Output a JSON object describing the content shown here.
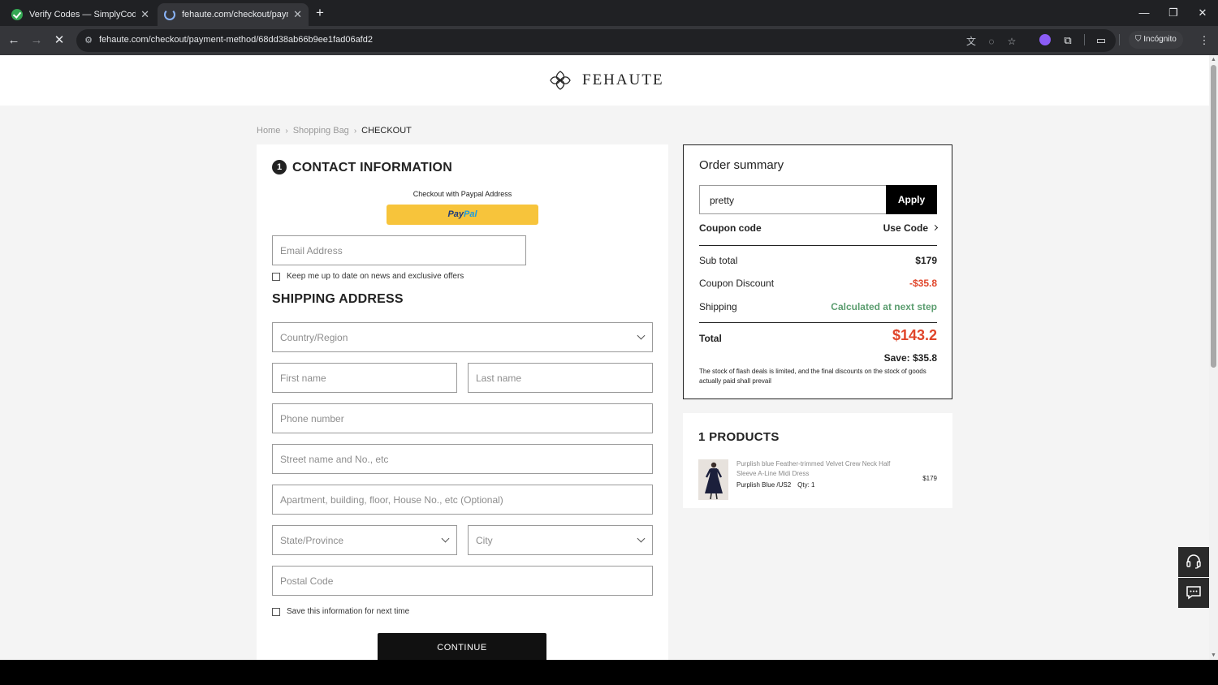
{
  "browser": {
    "tabs": [
      {
        "title": "Verify Codes — SimplyCodes",
        "active": false
      },
      {
        "title": "fehaute.com/checkout/paymen",
        "active": true
      }
    ],
    "url": "fehaute.com/checkout/payment-method/68dd38ab66b9ee1fad06afd2",
    "profile_label": "Incógnito",
    "icons": [
      "back-icon",
      "forward-icon",
      "stop-icon",
      "translate-icon",
      "eye-off-icon",
      "star-icon",
      "extension-icon",
      "puzzle-icon",
      "sidepanel-icon",
      "incognito-icon",
      "menu-icon"
    ]
  },
  "site": {
    "brand": "FEHAUTE",
    "breadcrumb": [
      "Home",
      "Shopping Bag",
      "CHECKOUT"
    ]
  },
  "contact": {
    "step": "1",
    "title": "CONTACT INFORMATION",
    "paypal_caption": "Checkout with Paypal Address",
    "paypal_label_1": "Pay",
    "paypal_label_2": "Pal",
    "email_placeholder": "Email Address",
    "newsletter_label": "Keep me up to date on news and exclusive offers"
  },
  "shipping": {
    "title": "SHIPPING ADDRESS",
    "country_placeholder": "Country/Region",
    "first_name_placeholder": "First name",
    "last_name_placeholder": "Last name",
    "phone_placeholder": "Phone number",
    "street_placeholder": "Street name and No., etc",
    "apartment_placeholder": "Apartment, building, floor, House No., etc (Optional)",
    "state_placeholder": "State/Province",
    "city_placeholder": "City",
    "postal_placeholder": "Postal Code",
    "save_info_label": "Save this information for next time",
    "continue_label": "CONTINUE"
  },
  "summary": {
    "title": "Order summary",
    "coupon_value": "pretty",
    "apply_label": "Apply",
    "coupon_code_label": "Coupon code",
    "use_code_label": "Use Code",
    "subtotal_label": "Sub total",
    "subtotal_value": "$179",
    "discount_label": "Coupon Discount",
    "discount_value": "-$35.8",
    "shipping_label": "Shipping",
    "shipping_value": "Calculated at next step",
    "total_label": "Total",
    "total_value": "$143.2",
    "save_text": "Save: $35.8",
    "stock_note": "The stock of flash deals is limited, and the final discounts on the stock of goods actually paid shall prevail",
    "colors": {
      "discount": "#e0452a",
      "shipping": "#5b9d6f"
    }
  },
  "products": {
    "title": "1 PRODUCTS",
    "items": [
      {
        "name": "Purplish blue Feather-trimmed Velvet Crew Neck Half Sleeve A-Line Midi Dress",
        "variant": "Purplish Blue /US2",
        "qty": "Qty: 1",
        "price": "$179"
      }
    ]
  },
  "widgets": [
    "headset-icon",
    "chat-icon"
  ]
}
